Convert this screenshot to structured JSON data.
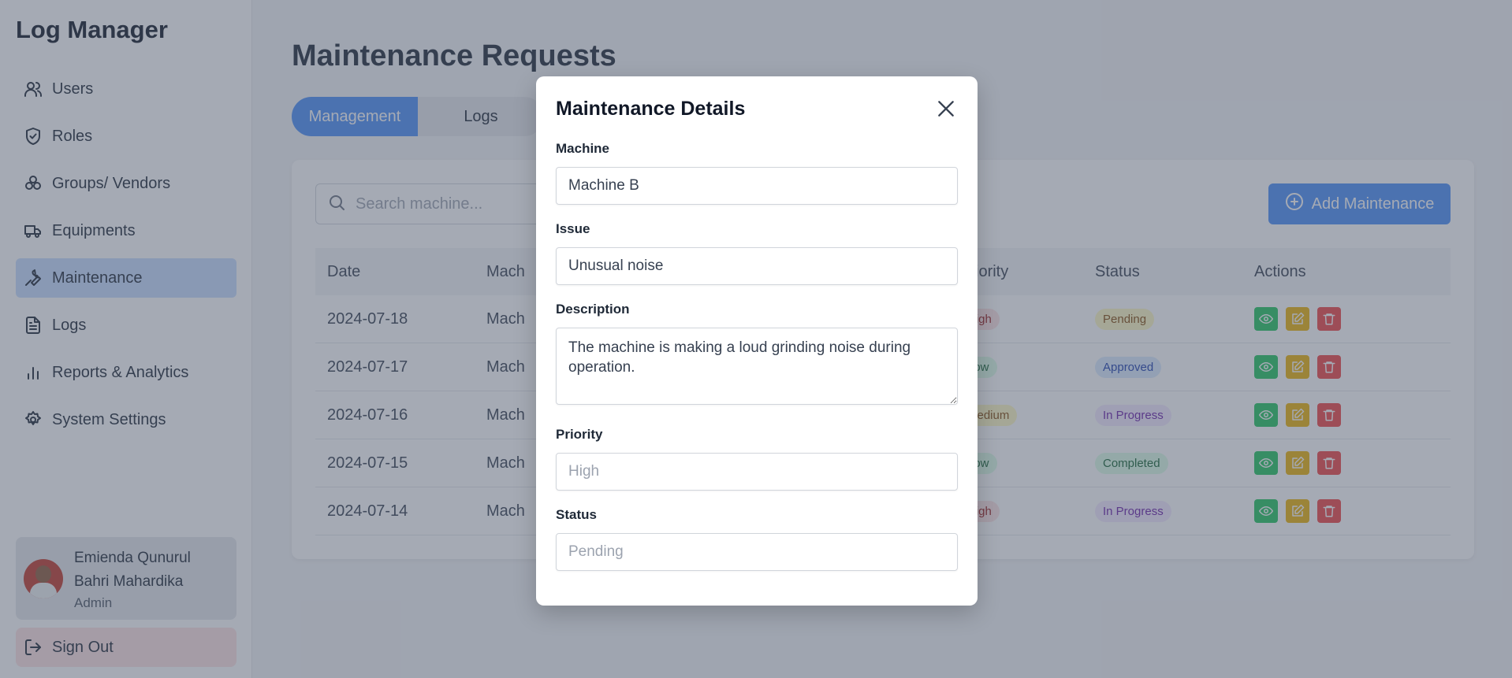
{
  "app": {
    "title": "Log Manager"
  },
  "sidebar": {
    "items": [
      {
        "label": "Users",
        "icon": "users-icon"
      },
      {
        "label": "Roles",
        "icon": "shield-icon"
      },
      {
        "label": "Groups/ Vendors",
        "icon": "groups-icon"
      },
      {
        "label": "Equipments",
        "icon": "truck-icon"
      },
      {
        "label": "Maintenance",
        "icon": "wrench-icon"
      },
      {
        "label": "Logs",
        "icon": "document-icon"
      },
      {
        "label": "Reports & Analytics",
        "icon": "chart-icon"
      },
      {
        "label": "System Settings",
        "icon": "gear-icon"
      }
    ],
    "active": "Maintenance",
    "user": {
      "name": "Emienda Qunurul Bahri Mahardika",
      "role": "Admin"
    },
    "signout_label": "Sign Out"
  },
  "main": {
    "title": "Maintenance Requests",
    "tabs": [
      {
        "label": "Management"
      },
      {
        "label": "Logs"
      }
    ],
    "search_placeholder": "Search machine...",
    "add_label": "Add Maintenance",
    "table": {
      "headers": {
        "date": "Date",
        "machine": "Mach",
        "priority": "Priority",
        "status": "Status",
        "actions": "Actions"
      },
      "rows": [
        {
          "date": "2024-07-18",
          "machine": "Mach",
          "priority": "High",
          "status": "Pending"
        },
        {
          "date": "2024-07-17",
          "machine": "Mach",
          "priority": "Low",
          "status": "Approved"
        },
        {
          "date": "2024-07-16",
          "machine": "Mach",
          "priority": "Medium",
          "status": "In Progress"
        },
        {
          "date": "2024-07-15",
          "machine": "Mach",
          "priority": "Low",
          "status": "Completed"
        },
        {
          "date": "2024-07-14",
          "machine": "Mach",
          "priority": "High",
          "status": "In Progress"
        }
      ]
    }
  },
  "modal": {
    "title": "Maintenance Details",
    "machine_label": "Machine",
    "machine_value": "Machine B",
    "issue_label": "Issue",
    "issue_value": "Unusual noise",
    "description_label": "Description",
    "description_value": "The machine is making a loud grinding noise during operation.",
    "priority_label": "Priority",
    "priority_placeholder": "High",
    "status_label": "Status",
    "status_placeholder": "Pending"
  },
  "colors": {
    "accent": "#4a8ef7",
    "active_nav": "#c7dcff",
    "signout_bg": "#fee2e2",
    "view": "#22c55e",
    "edit": "#eab308",
    "delete": "#ef4444"
  }
}
